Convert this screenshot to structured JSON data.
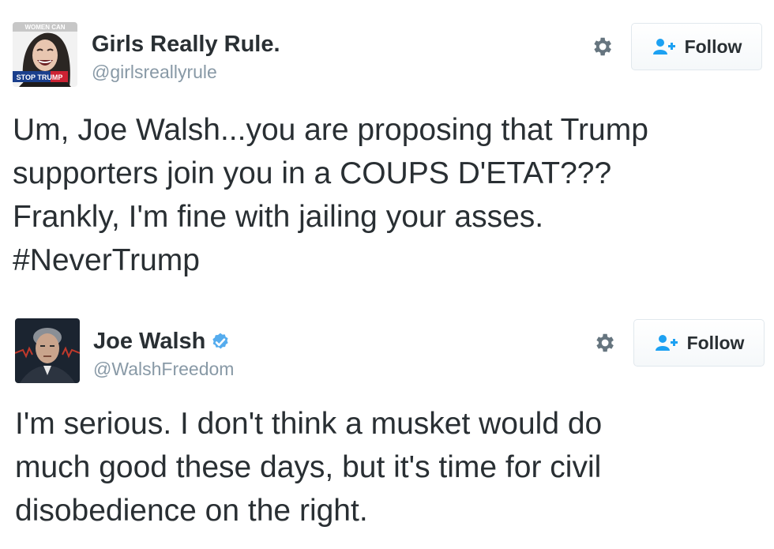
{
  "tweets": [
    {
      "display_name": "Girls Really Rule.",
      "handle": "@girlsreallyrule",
      "verified": false,
      "avatar": {
        "description_icon": "woman-laughing-avatar",
        "overlay_text_top": "WOMEN CAN",
        "overlay_text_bottom": "STOP TRUMP"
      },
      "settings_icon": "gear-icon",
      "follow_label": "Follow",
      "text": "Um, Joe Walsh...you are proposing that Trump\nsupporters join you in a COUPS D'ETAT???\nFrankly, I'm fine with jailing your asses.\n#NeverTrump"
    },
    {
      "display_name": "Joe Walsh",
      "handle": "@WalshFreedom",
      "verified": true,
      "avatar": {
        "description_icon": "man-portrait-avatar"
      },
      "settings_icon": "gear-icon",
      "follow_label": "Follow",
      "text": "I'm serious. I don't think a musket would do\nmuch good these days, but it's time for civil\ndisobedience on the right."
    }
  ],
  "colors": {
    "name": "#292f33",
    "handle": "#8899a6",
    "verified_blue": "#55acee",
    "follow_icon_blue": "#1da1f2",
    "gear": "#66757f",
    "button_border": "#e1e8ed"
  }
}
